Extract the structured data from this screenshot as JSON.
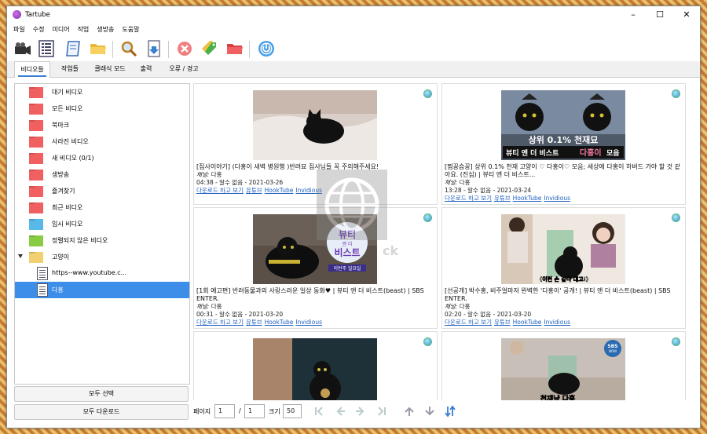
{
  "window": {
    "title": "Tartube"
  },
  "menu": [
    "파일",
    "수정",
    "미디어",
    "작업",
    "생방송",
    "도움말"
  ],
  "toolbar_icons": [
    "video-camera-icon",
    "list-icon",
    "scroll-icon",
    "open-folder-icon",
    "search-magnifier-icon",
    "download-icon",
    "stop-icon",
    "tags-icon",
    "red-folder-icon",
    "power-icon"
  ],
  "tabs": [
    "비디오들",
    "작업들",
    "클래식 모드",
    "출력",
    "오류 / 경고"
  ],
  "sidebar": {
    "items": [
      {
        "label": "대기 비디오",
        "color": "#f06060"
      },
      {
        "label": "모든 비디오",
        "color": "#f06060"
      },
      {
        "label": "북마크",
        "color": "#f06060"
      },
      {
        "label": "사라진 비디오",
        "color": "#f06060"
      },
      {
        "label": "새 비디오 (0/1)",
        "color": "#f06060"
      },
      {
        "label": "생방송",
        "color": "#f06060"
      },
      {
        "label": "즐겨찾기",
        "color": "#f06060"
      },
      {
        "label": "최근 비디오",
        "color": "#f06060"
      },
      {
        "label": "임시 비디오",
        "color": "#58b8e8"
      },
      {
        "label": "정렬되지 않은 비디오",
        "color": "#88cc44"
      },
      {
        "label": "고양이",
        "color": "#f0d070"
      },
      {
        "label": "https--www.youtube.c..."
      },
      {
        "label": "다홍"
      }
    ],
    "select_all": "모두 선택",
    "download_all": "모두 다운로드"
  },
  "videos": [
    {
      "title": "[집사이야기] (다홍이 새벽 병원행 )반려묘 집사님들 꼭 주의해주세요!",
      "channel_prefix": "채널:",
      "channel": "다홍",
      "duration": "04:38",
      "size": "알수 없음",
      "date": "2021-03-26",
      "links": [
        "다운로드 하고 보기",
        "유튜브",
        "HookTube",
        "Invidious"
      ]
    },
    {
      "title": "[찜꽁습꽁] 상위 0.1% 천재 고양이 ♡ 다홍이♡ 모음; 세상에 다홍이 하버드 가야 할 것 같아요. (진심) | 뷰티 앤 더 비스트...",
      "channel_prefix": "채널:",
      "channel": "다홍",
      "duration": "13:28",
      "size": "알수 없음",
      "date": "2021-03-24",
      "links": [
        "다운로드 하고 보기",
        "유튜브",
        "HookTube",
        "Invidious"
      ],
      "thumb_text": [
        "상위 0.1% 천재묘",
        "뷰티 앤 더 비스트",
        "다홍이",
        "모음"
      ]
    },
    {
      "title": "[1회 예고편] 반려동물과의 사랑스러운 일상 동화♥ | 뷰티 앤 더 비스트(beast) | SBS ENTER.",
      "channel_prefix": "채널:",
      "channel": "다홍",
      "duration": "00:31",
      "size": "알수 없음",
      "date": "2021-03-20",
      "links": [
        "다운로드 하고 보기",
        "유튜브",
        "HookTube",
        "Invidious"
      ],
      "thumb_text": [
        "뷰티",
        "앤 더",
        "비스트",
        "이번주 일요일"
      ]
    },
    {
      "title": "[선공개] 박수홍, 비주얼마저 완벽한 '다홍이' 공개! | 뷰티 앤 더 비스트(beast) | SBS ENTER.",
      "channel_prefix": "채널:",
      "channel": "다홍",
      "duration": "02:20",
      "size": "알수 없음",
      "date": "2021-03-20",
      "links": [
        "다운로드 하고 보기",
        "유튜브",
        "HookTube",
        "Invidious"
      ],
      "thumb_text": [
        "(이런 손 같다 대고!)"
      ]
    },
    {
      "title": "",
      "thumb_text": []
    },
    {
      "title": "",
      "thumb_text": [
        "SBS",
        "천재냥 다홍",
        "SBS NOW"
      ]
    }
  ],
  "pager": {
    "page_label": "페이지",
    "page": "1",
    "of_sep": "/",
    "total": "1",
    "size_label": "크기",
    "size": "50"
  },
  "watermark": "ck"
}
